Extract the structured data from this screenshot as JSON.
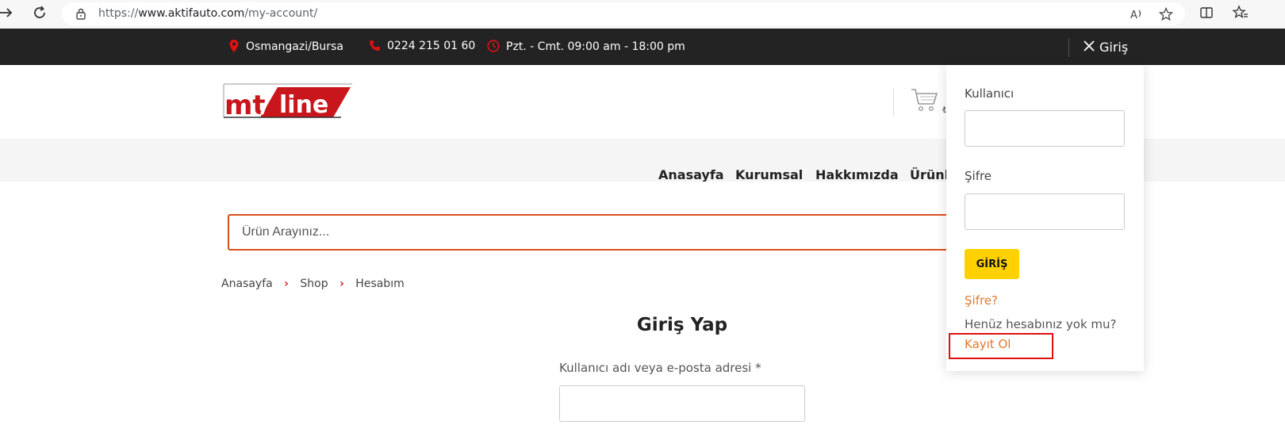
{
  "browser": {
    "url_prefix": "https://",
    "url_domain": "www.aktifauto.com",
    "url_path": "/my-account/"
  },
  "topbar": {
    "location": "Osmangazi/Bursa",
    "phone": "0224 215 01 60",
    "hours": "Pzt. - Cmt. 09:00 am - 18:00 pm",
    "login": "Giriş",
    "accent_color": "#e01010"
  },
  "logo": {
    "text": "mt line"
  },
  "menu": {
    "items": [
      "Anasayfa",
      "Kurumsal",
      "Hakkımızda",
      "Ürünle"
    ]
  },
  "search": {
    "placeholder": "Ürün Arayınız..."
  },
  "breadcrumb": {
    "items": [
      "Anasayfa",
      "Shop",
      "Hesabım"
    ]
  },
  "login_form": {
    "title": "Giriş Yap",
    "username_label": "Kullanıcı adı veya e-posta adresi *"
  },
  "dropdown": {
    "user_label": "Kullanıcı",
    "password_label": "Şifre",
    "submit": "GİRİŞ",
    "forgot": "Şifre?",
    "no_account": "Henüz hesabınız yok mu?",
    "register": "Kayıt Ol",
    "button_color": "#ffd100",
    "link_color": "#e07a2e"
  }
}
